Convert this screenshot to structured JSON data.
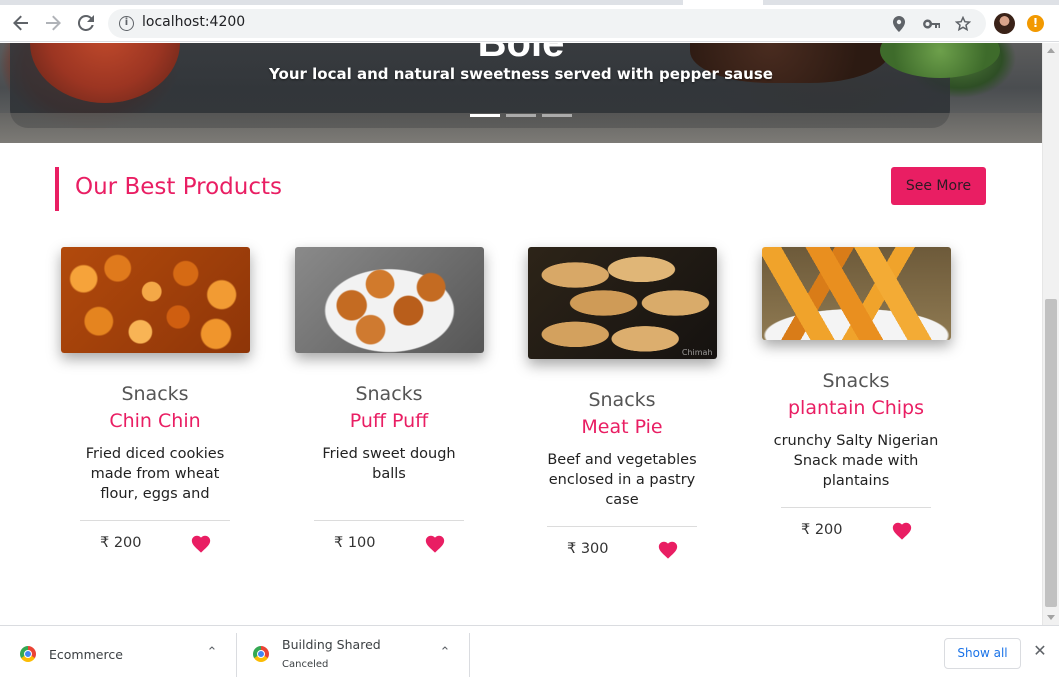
{
  "browser": {
    "url": "localhost:4200",
    "alert_badge": "!"
  },
  "hero": {
    "title_partial": "Bole",
    "caption": "Your local and natural sweetness served with pepper sause",
    "slides": 3,
    "active_slide": 1
  },
  "section": {
    "title": "Our Best Products",
    "see_more_label": "See More"
  },
  "products": [
    {
      "category": "Snacks",
      "name": "Chin Chin",
      "description": "Fried diced cookies made from wheat flour, eggs and",
      "price": "₹ 200",
      "image": "chin-chin-image"
    },
    {
      "category": "Snacks",
      "name": "Puff Puff",
      "description": "Fried sweet dough balls",
      "price": "₹ 100",
      "image": "puff-puff-image"
    },
    {
      "category": "Snacks",
      "name": "Meat Pie",
      "description": "Beef and vegetables enclosed in a pastry case",
      "price": "₹ 300",
      "image": "meat-pie-image",
      "watermark": "Chimah"
    },
    {
      "category": "Snacks",
      "name": "plantain Chips",
      "description": "crunchy Salty Nigerian Snack made with plantains",
      "price": "₹ 200",
      "image": "plantain-chips-image"
    }
  ],
  "downloads": {
    "items": [
      {
        "name": "Ecommerce",
        "status": ""
      },
      {
        "name": "Building Shared",
        "status": "Canceled"
      }
    ],
    "show_all_label": "Show all"
  },
  "colors": {
    "accent": "#e91e63",
    "link": "#1a73e8"
  }
}
